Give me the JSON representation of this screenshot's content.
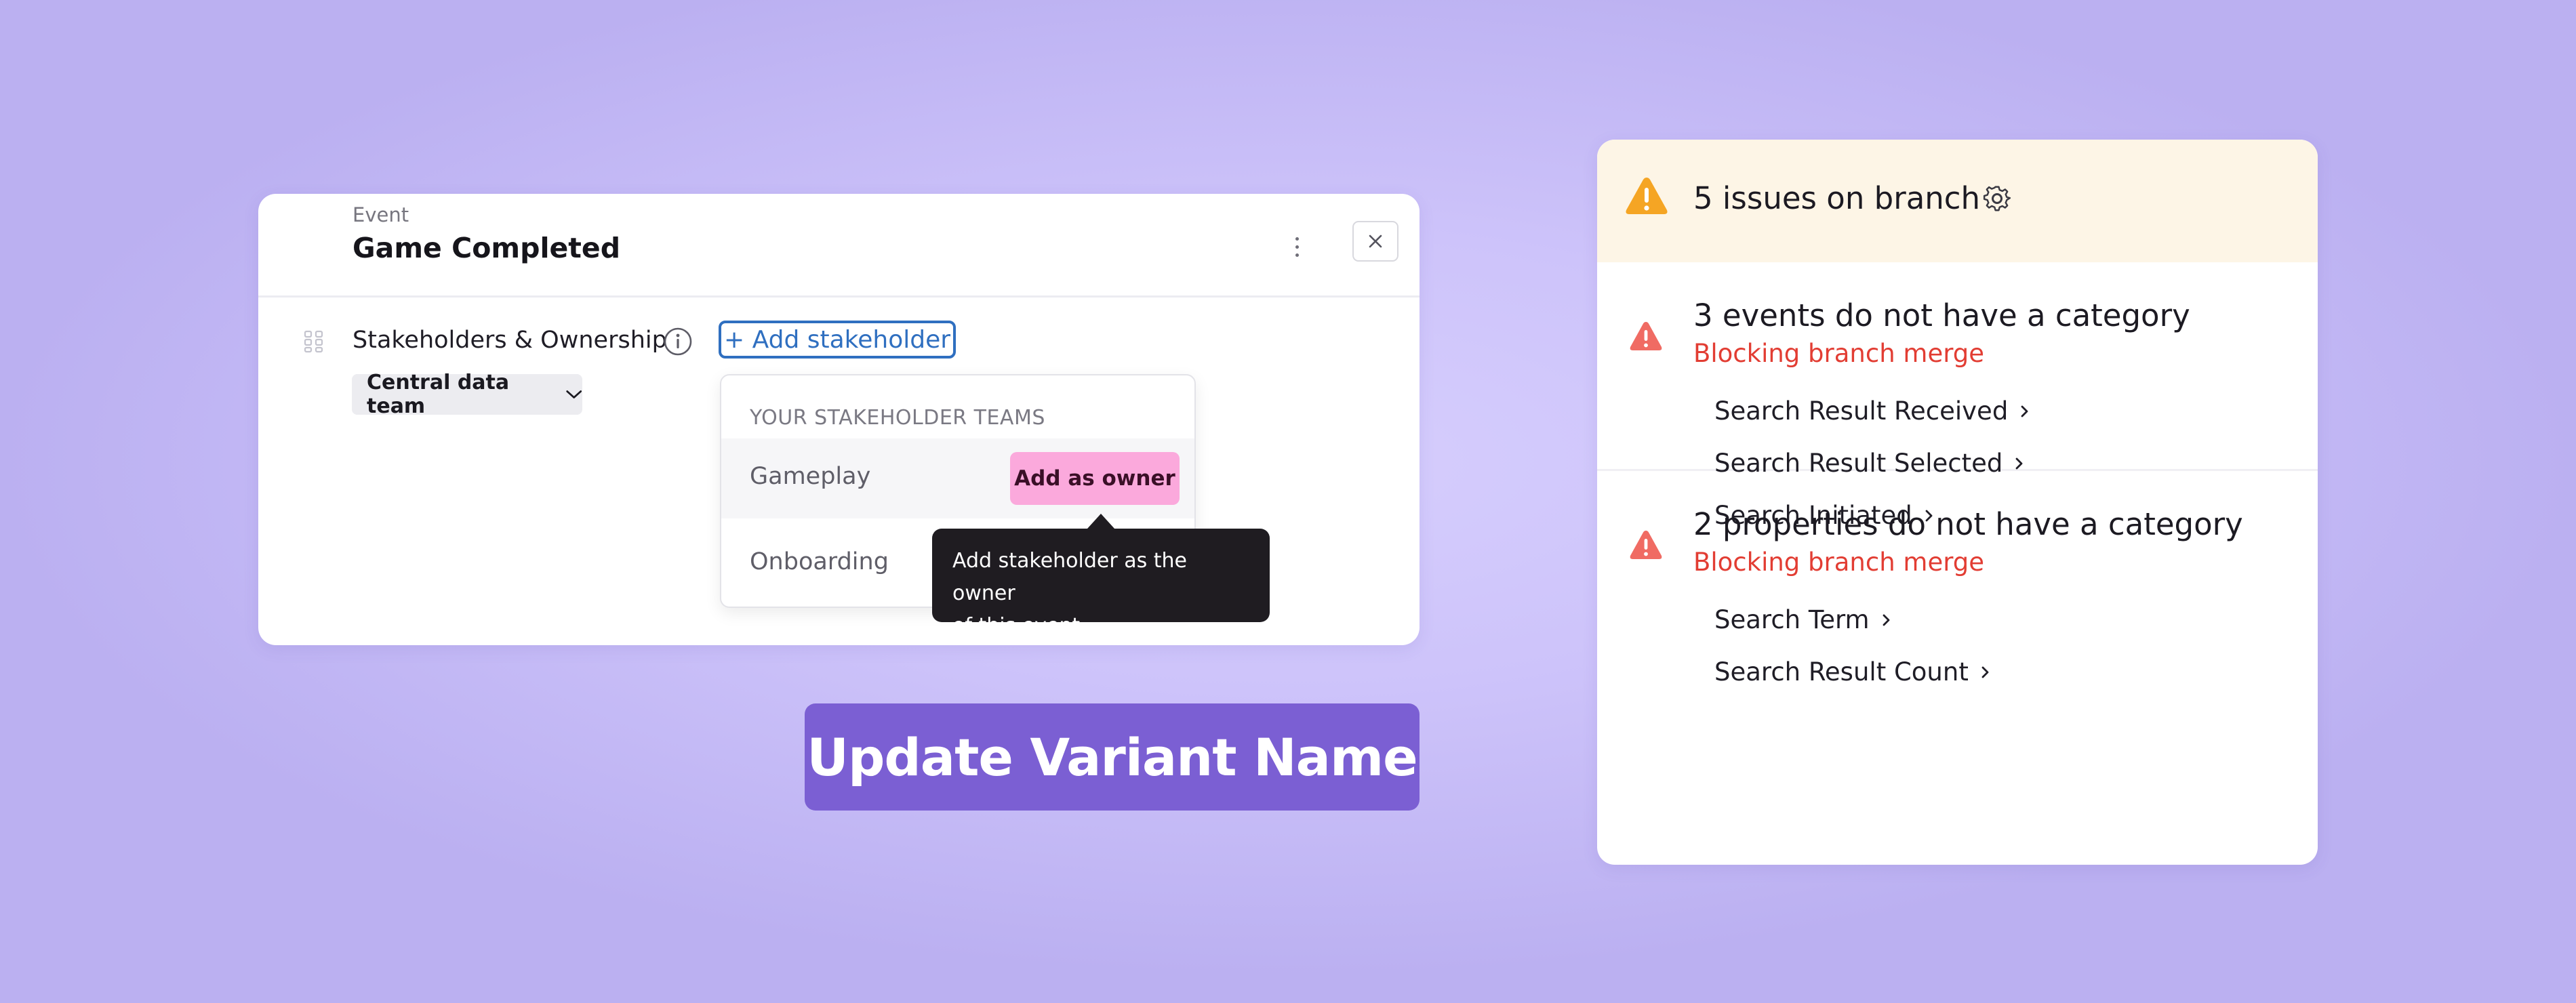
{
  "event_panel": {
    "type_label": "Event",
    "event_name": "Game Completed",
    "section_label": "Stakeholders & Ownership",
    "add_stakeholder_label": "+ Add stakeholder",
    "owner_team": "Central data team",
    "dropdown": {
      "heading": "YOUR STAKEHOLDER TEAMS",
      "teams": [
        {
          "name": "Gameplay",
          "action": "Add as owner"
        },
        {
          "name": "Onboarding"
        }
      ]
    },
    "tooltip": {
      "line1": "Add stakeholder as the owner",
      "line2": "of this event"
    }
  },
  "update_button": {
    "label": "Update Variant Name"
  },
  "issues_panel": {
    "title": "5 issues on branch",
    "groups": [
      {
        "title": "3 events do not have a category",
        "subtitle": "Blocking branch merge",
        "items": [
          "Search Result Received",
          "Search Result Selected",
          "Search Initiated"
        ]
      },
      {
        "title": "2 properties do not have a category",
        "subtitle": "Blocking branch merge",
        "items": [
          "Search Term",
          "Search Result Count"
        ]
      }
    ]
  },
  "colors": {
    "background": "#cdc3fa",
    "link_blue": "#2f6fc0",
    "owner_button_pink": "#fba9dc",
    "update_button_purple": "#7b5fd3",
    "warning_amber": "#f5a524",
    "error_red": "#e23d33",
    "issues_header_bg": "#fdf5e6"
  },
  "icons": [
    "drag-handle-icon",
    "info-icon",
    "chevron-down-icon",
    "more-vertical-icon",
    "close-icon",
    "warning-icon",
    "gear-icon",
    "chevron-right-icon"
  ]
}
